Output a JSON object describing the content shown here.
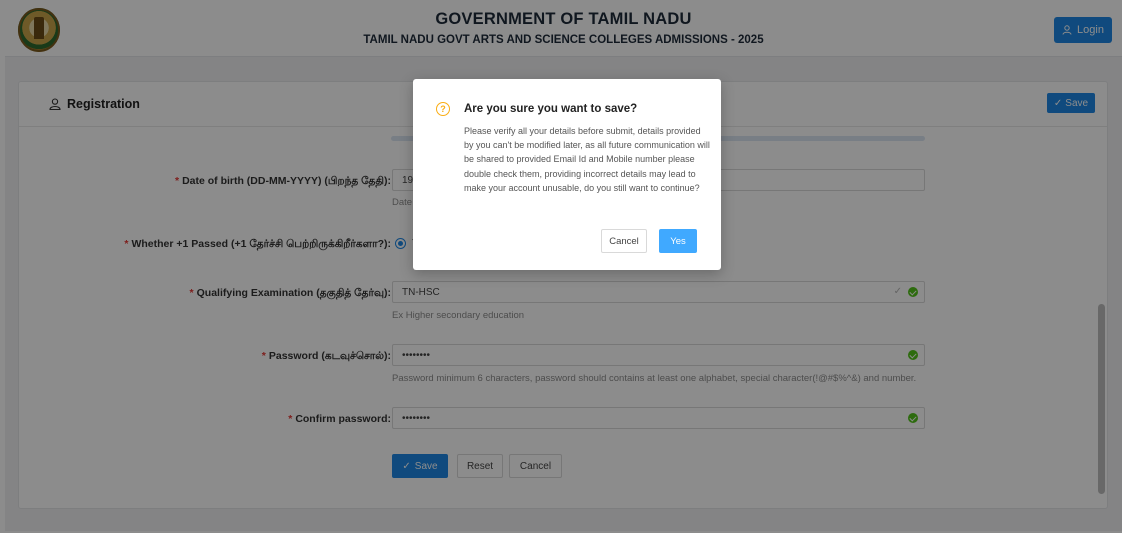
{
  "header": {
    "title": "GOVERNMENT OF TAMIL NADU",
    "subtitle": "TAMIL NADU GOVT ARTS AND SCIENCE COLLEGES ADMISSIONS - 2025",
    "login_label": "Login",
    "login_icon": "user-icon",
    "brand_color": "#1e88e5"
  },
  "card": {
    "title": "Registration",
    "title_icon": "user-icon",
    "save_label": "Save"
  },
  "form": {
    "dob": {
      "label": "Date of birth (DD-MM-YYYY) (பிறந்த தேதி):",
      "value": "19-",
      "hint": "Date"
    },
    "plus_one": {
      "label": "Whether +1 Passed (+1 தேர்ச்சி பெற்றிருக்கிறீர்களா?):",
      "selected": "Y"
    },
    "qualifying": {
      "label": "Qualifying Examination (தகுதித் தேர்வு):",
      "value": "TN-HSC",
      "hint": "Ex Higher secondary education"
    },
    "password": {
      "label": "Password (கடவுச்சொல்):",
      "value": "••••••••",
      "hint": "Password minimum 6 characters, password should contains at least one alphabet, special character(!@#$%^&) and number."
    },
    "confirm": {
      "label": "Confirm password:",
      "value": "••••••••"
    },
    "save_label": "Save",
    "reset_label": "Reset",
    "cancel_label": "Cancel"
  },
  "modal": {
    "icon": "question-circle-icon",
    "title": "Are you sure you want to save?",
    "body": "Please verify all your details before submit, details provided by you can't be modified later, as all future communication will be shared to provided Email Id and Mobile number please double check them, providing incorrect details may lead to make your account unusable, do you still want to continue?",
    "cancel_label": "Cancel",
    "yes_label": "Yes"
  }
}
